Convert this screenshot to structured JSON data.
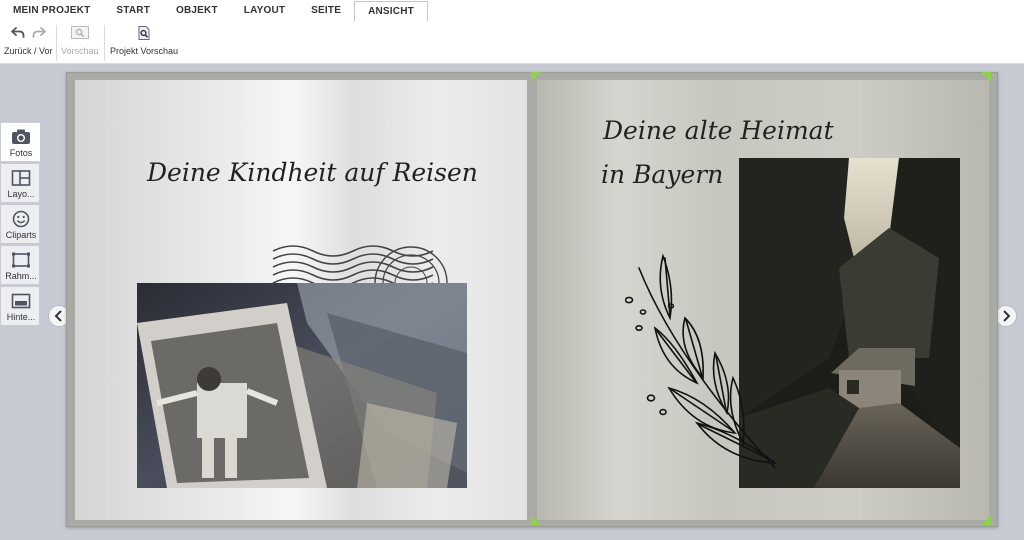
{
  "tabs": [
    {
      "label": "MEIN PROJEKT",
      "active": false
    },
    {
      "label": "START",
      "active": false
    },
    {
      "label": "OBJEKT",
      "active": false
    },
    {
      "label": "LAYOUT",
      "active": false
    },
    {
      "label": "SEITE",
      "active": false
    },
    {
      "label": "ANSICHT",
      "active": true
    }
  ],
  "toolbar": {
    "undo_redo_label": "Zurück / Vor",
    "preview_label": "Vorschau",
    "project_preview_label": "Projekt Vorschau"
  },
  "sidebar": {
    "items": [
      {
        "label": "Fotos",
        "icon": "camera-icon",
        "active": true
      },
      {
        "label": "Layo...",
        "icon": "layout-icon",
        "active": false
      },
      {
        "label": "Cliparts",
        "icon": "smiley-icon",
        "active": false
      },
      {
        "label": "Rahm...",
        "icon": "frame-icon",
        "active": false
      },
      {
        "label": "Hinte...",
        "icon": "background-icon",
        "active": false
      }
    ]
  },
  "left_page": {
    "title": "Deine Kindheit auf Reisen"
  },
  "right_page": {
    "title_line1": "Deine alte Heimat",
    "title_line2": "in Bayern"
  },
  "colors": {
    "accent_corner": "#8fd14f",
    "workspace_bg": "#c7cad3"
  }
}
